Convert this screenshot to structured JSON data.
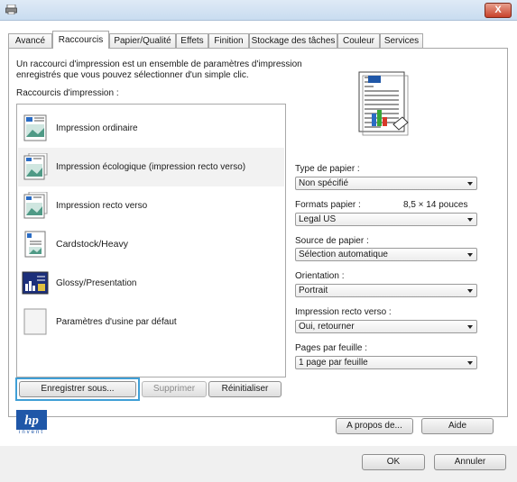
{
  "window": {
    "close_label": "X"
  },
  "tabs": [
    {
      "label": "Avancé"
    },
    {
      "label": "Raccourcis"
    },
    {
      "label": "Papier/Qualité"
    },
    {
      "label": "Effets"
    },
    {
      "label": "Finition"
    },
    {
      "label": "Stockage des tâches"
    },
    {
      "label": "Couleur"
    },
    {
      "label": "Services"
    }
  ],
  "intro": {
    "line1": "Un raccourci d'impression est un ensemble de paramètres d'impression",
    "line2": "enregistrés que vous pouvez sélectionner d'un simple clic.",
    "list_label": "Raccourcis d'impression :"
  },
  "shortcuts": [
    {
      "label": "Impression ordinaire",
      "icon": "document-landscape-icon"
    },
    {
      "label": "Impression écologique (impression recto verso)",
      "icon": "duplex-document-icon"
    },
    {
      "label": "Impression recto verso",
      "icon": "duplex-document-icon"
    },
    {
      "label": "Cardstock/Heavy",
      "icon": "cardstock-icon"
    },
    {
      "label": "Glossy/Presentation",
      "icon": "presentation-icon"
    },
    {
      "label": "Paramètres d'usine par défaut",
      "icon": "blank-document-icon"
    }
  ],
  "settings": {
    "paper_type": {
      "label": "Type de papier :",
      "value": "Non spécifié"
    },
    "paper_size": {
      "label": "Formats papier :",
      "dims": "8,5 × 14 pouces",
      "value": "Legal US"
    },
    "paper_source": {
      "label": "Source de papier :",
      "value": "Sélection automatique"
    },
    "orientation": {
      "label": "Orientation :",
      "value": "Portrait"
    },
    "duplex": {
      "label": "Impression recto verso :",
      "value": "Oui, retourner"
    },
    "pages_per_sheet": {
      "label": "Pages par feuille :",
      "value": "1 page par feuille"
    }
  },
  "buttons": {
    "save_as": "Enregistrer sous...",
    "delete": "Supprimer",
    "reset": "Réinitialiser",
    "about": "A propos de...",
    "help": "Aide",
    "ok": "OK",
    "cancel": "Annuler"
  },
  "logo": {
    "brand": "hp",
    "tagline": "invent"
  },
  "colors": {
    "highlight": "#3f9fd6",
    "hp_blue": "#1f57a8"
  }
}
